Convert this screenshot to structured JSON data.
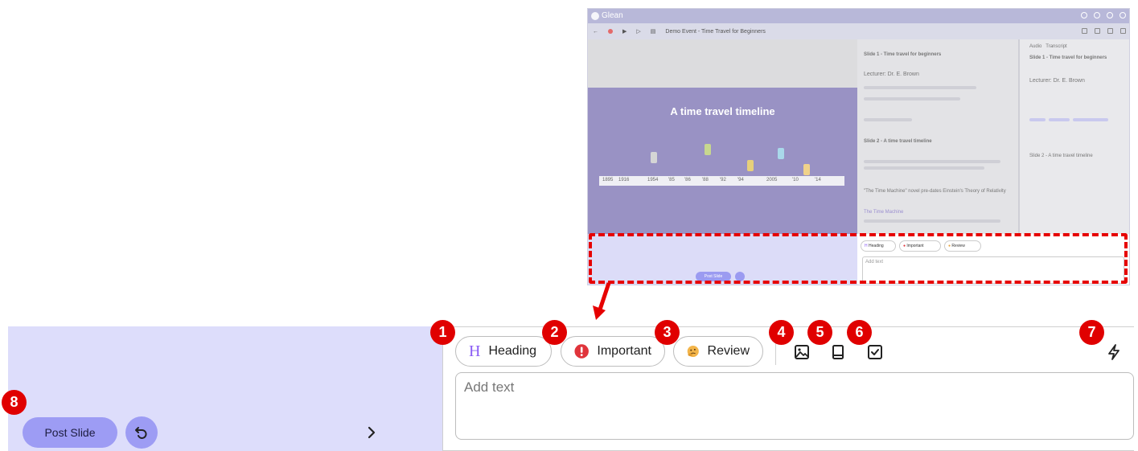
{
  "mini": {
    "app_name": "Glean",
    "event_title": "Demo Event - Time Travel for Beginners",
    "slide_title": "A time travel timeline",
    "timeline_years": [
      "1895",
      "1916",
      "1954",
      "'85",
      "'86",
      "'88",
      "'92",
      "'94",
      "2005",
      "'10",
      "'14"
    ],
    "notes": {
      "slide1_heading": "Slide 1 - Time travel for beginners",
      "lecturer": "Lecturer: Dr. E. Brown",
      "slide2_heading": "Slide 2 - A time travel timeline",
      "quote": "\"The Time Machine\" novel pre-dates Einstein's Theory of Relativity",
      "wiki": "The Time Machine"
    },
    "right_panel": {
      "tabs": [
        "Audio",
        "Transcript"
      ],
      "slide1": "Slide 1 - Time travel for beginners",
      "lecturer": "Lecturer: Dr. E. Brown",
      "slide2": "Slide 2 - A time travel timeline"
    },
    "pills": [
      "Heading",
      "Important",
      "Review"
    ],
    "add_text_placeholder": "Add text",
    "post_label": "Post Slide"
  },
  "editor": {
    "pills": [
      {
        "label": "Heading",
        "icon": "heading-icon"
      },
      {
        "label": "Important",
        "icon": "exclamation-icon"
      },
      {
        "label": "Review",
        "icon": "thinking-emoji-icon"
      }
    ],
    "add_text_placeholder": "Add text",
    "tools": [
      "image-icon",
      "bookmark-icon",
      "checkbox-icon",
      "lightning-icon"
    ]
  },
  "controls": {
    "post_label": "Post Slide"
  },
  "badges": [
    "1",
    "2",
    "3",
    "4",
    "5",
    "6",
    "7",
    "8"
  ],
  "colors": {
    "accent": "#9d9cf4",
    "badge_red": "#e00000",
    "heading_purple": "#8a5cf5",
    "important_red": "#e0343b",
    "slide_purple": "#9992c4"
  }
}
